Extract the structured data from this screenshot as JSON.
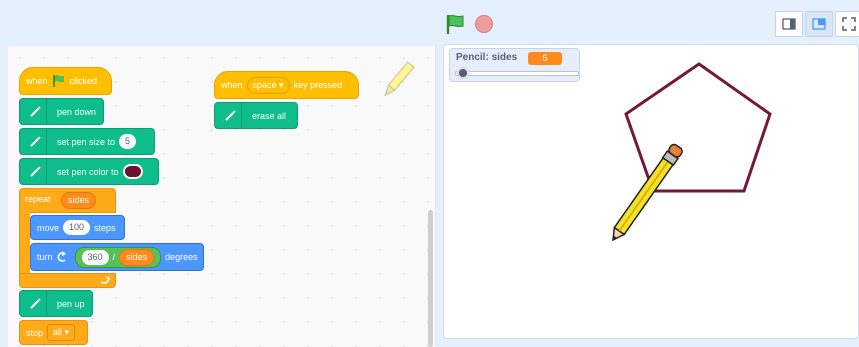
{
  "controls": {
    "green_flag_icon": "green-flag-icon",
    "stop_icon": "stop-icon"
  },
  "view_buttons": [
    "small-stage-icon",
    "normal-stage-icon",
    "fullscreen-icon"
  ],
  "script1": {
    "when_flag": {
      "before": "when",
      "after": "clicked"
    },
    "pen_down": "pen down",
    "set_size": {
      "label": "set pen size to",
      "value": "5"
    },
    "set_color": {
      "label": "set pen color to",
      "color": "#6b1230"
    },
    "repeat": {
      "label": "repeat",
      "var": "sides"
    },
    "move": {
      "label1": "move",
      "value": "100",
      "label2": "steps"
    },
    "turn": {
      "label1": "turn",
      "numerator": "360",
      "op": "/",
      "var": "sides",
      "label2": "degrees"
    },
    "pen_up": "pen up",
    "stop": {
      "label": "stop",
      "option": "all"
    }
  },
  "script2": {
    "when_key": {
      "before": "when",
      "key": "space",
      "after": "key pressed"
    },
    "erase_all": "erase all"
  },
  "monitor": {
    "label": "Pencil: sides",
    "value": "5",
    "slider_fraction": 0.0
  },
  "stage": {
    "pentagon_color": "#731a36",
    "pencil_color": "#f5e02a"
  },
  "accent": {
    "events": "#ffbf00",
    "pen": "#0fbd8c",
    "control": "#ffab19",
    "motion": "#4c97ff",
    "operators": "#59c059",
    "variables": "#ff8c1a"
  }
}
